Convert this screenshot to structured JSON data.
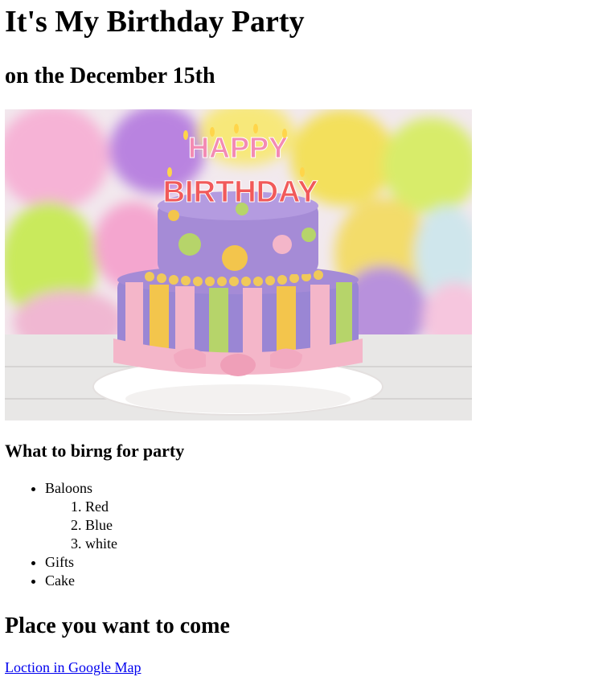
{
  "page": {
    "title": "It's My Birthday Party",
    "date_heading": "on the December 15th",
    "image": {
      "cake_topper_line1": "HAPPY",
      "cake_topper_line2": "BIRTHDAY"
    },
    "bring_heading": "What to birng for party",
    "bring_items": [
      {
        "label": "Baloons",
        "sub": [
          "Red",
          "Blue",
          "white"
        ]
      },
      {
        "label": "Gifts"
      },
      {
        "label": "Cake"
      }
    ],
    "place_heading": "Place you want to come",
    "map_link_label": "Loction in Google Map"
  },
  "colors": {
    "link": "#0000ee",
    "text": "#000000",
    "cake_top": "#a58bd6",
    "cake_bottom": "#9a86d4",
    "ribbon_pink": "#f4b6c9",
    "stripe_yellow": "#f3c54c",
    "stripe_green": "#b6d46a"
  }
}
